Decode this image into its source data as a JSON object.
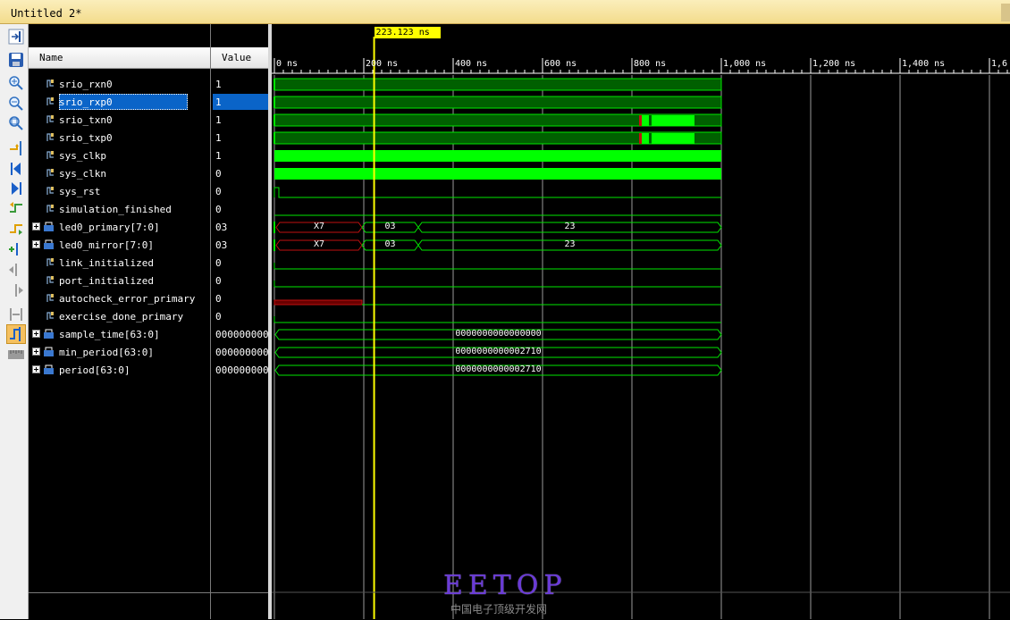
{
  "window": {
    "title": "Untitled 2*"
  },
  "colors": {
    "wave_high": "#00e600",
    "wave_dark": "#006000",
    "bus_red": "#c01010",
    "cursor": "#ffff00",
    "selection": "#0a64c8"
  },
  "toolbar_icons": [
    "float-dock-icon",
    "save-icon",
    "zoom-in-icon",
    "zoom-out-icon",
    "zoom-fit-icon",
    "goto-cursor-icon",
    "goto-start-icon",
    "goto-end-icon",
    "previous-transition-icon",
    "next-transition-icon",
    "add-marker-icon",
    "previous-marker-icon",
    "next-marker-icon",
    "swap-cursors-icon",
    "snap-to-transition-icon",
    "floating-ruler-icon"
  ],
  "columns": {
    "name": "Name",
    "value": "Value"
  },
  "cursor": {
    "label": "223.123 ns",
    "time_ns": 223.123
  },
  "timeline": {
    "tick_labels": [
      "0 ns",
      "200 ns",
      "400 ns",
      "600 ns",
      "800 ns",
      "1,000 ns",
      "1,200 ns",
      "1,400 ns",
      "1,6"
    ],
    "major_ticks_ns": [
      0,
      200,
      400,
      600,
      800,
      1000,
      1200,
      1400,
      1600
    ],
    "sim_end_ns": 1000
  },
  "signals": [
    {
      "name": "srio_rxn0",
      "value": "1",
      "bus": false,
      "selected": false
    },
    {
      "name": "srio_rxp0",
      "value": "1",
      "bus": false,
      "selected": true
    },
    {
      "name": "srio_txn0",
      "value": "1",
      "bus": false,
      "selected": false
    },
    {
      "name": "srio_txp0",
      "value": "1",
      "bus": false,
      "selected": false
    },
    {
      "name": "sys_clkp",
      "value": "1",
      "bus": false,
      "selected": false
    },
    {
      "name": "sys_clkn",
      "value": "0",
      "bus": false,
      "selected": false
    },
    {
      "name": "sys_rst",
      "value": "0",
      "bus": false,
      "selected": false
    },
    {
      "name": "simulation_finished",
      "value": "0",
      "bus": false,
      "selected": false
    },
    {
      "name": "led0_primary[7:0]",
      "value": "03",
      "bus": true,
      "selected": false
    },
    {
      "name": "led0_mirror[7:0]",
      "value": "03",
      "bus": true,
      "selected": false
    },
    {
      "name": "link_initialized",
      "value": "0",
      "bus": false,
      "selected": false
    },
    {
      "name": "port_initialized",
      "value": "0",
      "bus": false,
      "selected": false
    },
    {
      "name": "autocheck_error_primary",
      "value": "0",
      "bus": false,
      "selected": false
    },
    {
      "name": "exercise_done_primary",
      "value": "0",
      "bus": false,
      "selected": false
    },
    {
      "name": "sample_time[63:0]",
      "value": "0000000000",
      "bus": true,
      "selected": false
    },
    {
      "name": "min_period[63:0]",
      "value": "0000000000",
      "bus": true,
      "selected": false
    },
    {
      "name": "period[63:0]",
      "value": "0000000000",
      "bus": true,
      "selected": false
    }
  ],
  "bus_values": {
    "led0_primary": [
      "X7",
      "03",
      "23"
    ],
    "led0_mirror": [
      "X7",
      "03",
      "23"
    ],
    "sample_time": "0000000000000000",
    "min_period": "0000000000002710",
    "period": "0000000000002710"
  },
  "watermark": {
    "brand": "EETOP",
    "tagline": "中国电子顶级开发网"
  }
}
